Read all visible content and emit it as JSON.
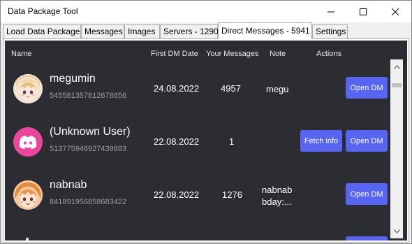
{
  "window": {
    "title": "Data Package Tool"
  },
  "tabs": [
    {
      "label": "Load Data Package"
    },
    {
      "label": "Messages"
    },
    {
      "label": "Images"
    },
    {
      "label": "Servers - 1290"
    },
    {
      "label": "Direct Messages - 5941"
    },
    {
      "label": "Settings"
    }
  ],
  "table": {
    "headers": {
      "name": "Name",
      "first_dm_date": "First DM Date",
      "your_messages": "Your Messages",
      "note": "Note",
      "actions": "Actions"
    },
    "rows": [
      {
        "name": "megumin",
        "id": "545581357812678656",
        "date": "24.08.2022",
        "messages": "4957",
        "note": "megu",
        "open_label": "Open DM",
        "avatar": "anime-avatar-icon"
      },
      {
        "name": "(Unknown User)",
        "id": "513775946927439883",
        "date": "22.08.2022",
        "messages": "1",
        "note": "",
        "fetch_label": "Fetch info",
        "open_label": "Open DM",
        "avatar": "discord-logo-icon"
      },
      {
        "name": "nabnab",
        "id": "841891956858683422",
        "date": "22.08.2022",
        "messages": "1276",
        "note_line1": "nabnab",
        "note_line2": "bday:...",
        "open_label": "Open DM",
        "avatar": "anime-avatar-icon"
      }
    ]
  },
  "colors": {
    "panel_bg": "#2b2d33",
    "button": "#5865f2",
    "discord_pink": "#eb459e"
  }
}
